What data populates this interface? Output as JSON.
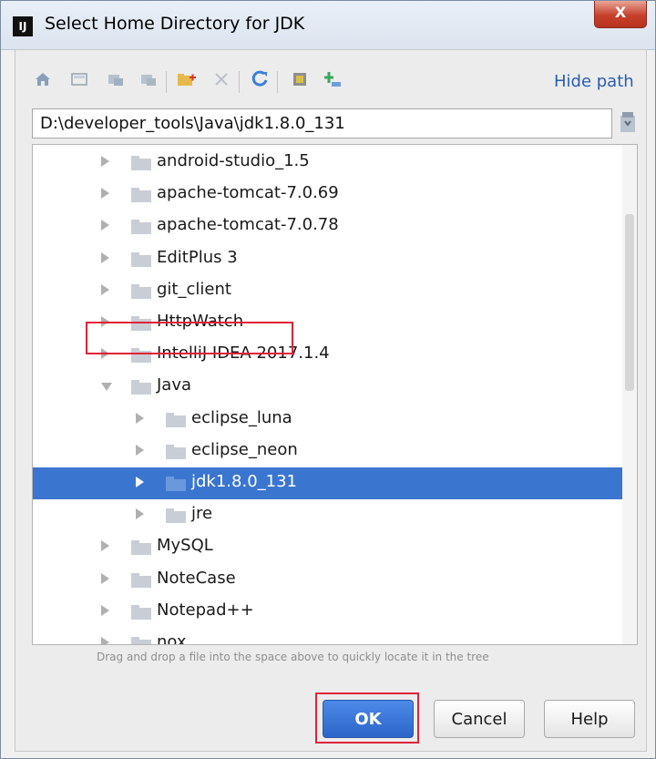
{
  "window": {
    "title": "Select Home Directory for JDK",
    "app_icon_text": "IJ",
    "close_glyph": "X"
  },
  "toolbar": {
    "icons": [
      "home-icon",
      "desktop-icon",
      "project-icon",
      "module-icon",
      "new-folder-icon",
      "delete-icon",
      "refresh-icon",
      "show-hidden-icon",
      "add-path-icon"
    ],
    "hide_path_label": "Hide path"
  },
  "path": {
    "value": "D:\\developer_tools\\Java\\jdk1.8.0_131"
  },
  "tree": {
    "items": [
      {
        "label": "android-studio_1.5",
        "level": 0,
        "expanded": false,
        "selected": false
      },
      {
        "label": "apache-tomcat-7.0.69",
        "level": 0,
        "expanded": false,
        "selected": false
      },
      {
        "label": "apache-tomcat-7.0.78",
        "level": 0,
        "expanded": false,
        "selected": false
      },
      {
        "label": "EditPlus 3",
        "level": 0,
        "expanded": false,
        "selected": false
      },
      {
        "label": "git_client",
        "level": 0,
        "expanded": false,
        "selected": false
      },
      {
        "label": "HttpWatch",
        "level": 0,
        "expanded": false,
        "selected": false
      },
      {
        "label": "IntelliJ IDEA 2017.1.4",
        "level": 0,
        "expanded": false,
        "selected": false
      },
      {
        "label": "Java",
        "level": 0,
        "expanded": true,
        "selected": false
      },
      {
        "label": "eclipse_luna",
        "level": 1,
        "expanded": false,
        "selected": false
      },
      {
        "label": "eclipse_neon",
        "level": 1,
        "expanded": false,
        "selected": false
      },
      {
        "label": "jdk1.8.0_131",
        "level": 1,
        "expanded": false,
        "selected": true
      },
      {
        "label": "jre",
        "level": 1,
        "expanded": false,
        "selected": false
      },
      {
        "label": "MySQL",
        "level": 0,
        "expanded": false,
        "selected": false
      },
      {
        "label": "NoteCase",
        "level": 0,
        "expanded": false,
        "selected": false
      },
      {
        "label": "Notepad++",
        "level": 0,
        "expanded": false,
        "selected": false
      },
      {
        "label": "nox",
        "level": 0,
        "expanded": false,
        "selected": false
      }
    ]
  },
  "hint": "Drag and drop a file into the space above to quickly locate it in the tree",
  "buttons": {
    "ok": "OK",
    "cancel": "Cancel",
    "help": "Help"
  },
  "colors": {
    "selection": "#3a75d0",
    "annotation_red": "#e0223a",
    "link_blue": "#2a5db0"
  }
}
